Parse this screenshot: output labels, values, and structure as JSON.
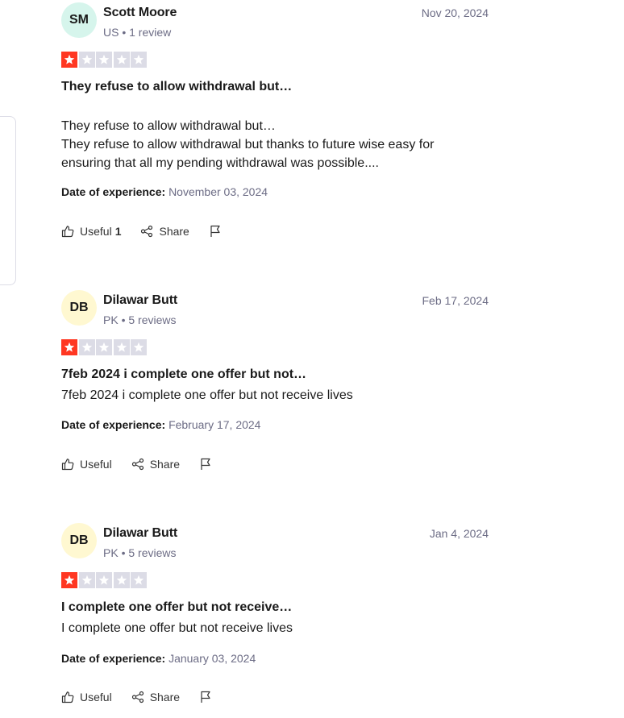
{
  "reviews": [
    {
      "initials": "SM",
      "avatar_color": "#d6f5ec",
      "name": "Scott Moore",
      "meta": "US • 1 review",
      "date": "Nov 20, 2024",
      "rating": 1,
      "title": "They refuse to allow withdrawal but…",
      "body_lines": [
        "They refuse to allow withdrawal but…",
        "They refuse to allow withdrawal but thanks to future wise easy for",
        "ensuring that all my pending withdrawal was possible...."
      ],
      "experience_label": "Date of experience:",
      "experience_date": "November 03, 2024",
      "useful_label": "Useful",
      "useful_count": "1",
      "share_label": "Share"
    },
    {
      "initials": "DB",
      "avatar_color": "#fff8d1",
      "name": "Dilawar Butt",
      "meta": "PK • 5 reviews",
      "date": "Feb 17, 2024",
      "rating": 1,
      "title": "7feb 2024 i complete one offer but not…",
      "body_lines": [
        "7feb 2024 i complete one offer but not receive lives"
      ],
      "experience_label": "Date of experience:",
      "experience_date": "February 17, 2024",
      "useful_label": "Useful",
      "useful_count": "",
      "share_label": "Share"
    },
    {
      "initials": "DB",
      "avatar_color": "#fff8d1",
      "name": "Dilawar Butt",
      "meta": "PK • 5 reviews",
      "date": "Jan 4, 2024",
      "rating": 1,
      "title": "I complete one offer but not receive…",
      "body_lines": [
        "I complete one offer but not receive lives"
      ],
      "experience_label": "Date of experience:",
      "experience_date": "January 03, 2024",
      "useful_label": "Useful",
      "useful_count": "",
      "share_label": "Share"
    }
  ],
  "colors": {
    "star_on": "#ff3722",
    "star_off": "#dcdce6",
    "muted_text": "#6c6c85"
  },
  "icons": {
    "useful": "thumbs-up-icon",
    "share": "share-icon",
    "report": "flag-icon",
    "star": "star-icon"
  }
}
